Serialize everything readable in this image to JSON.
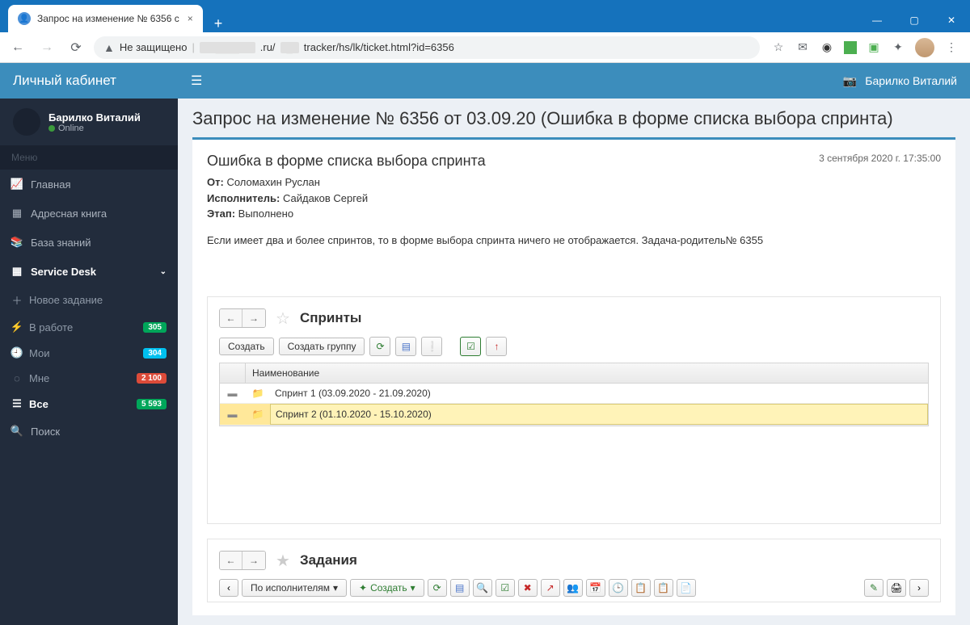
{
  "browser": {
    "tab_title": "Запрос на изменение № 6356 с",
    "url_prefix": "Не защищено",
    "url_path": "tracker/hs/lk/ticket.html?id=6356",
    "url_domain_suffix": ".ru/"
  },
  "app": {
    "logo": "Личный кабинет",
    "user_name": "Барилко Виталий",
    "user_status": "Online",
    "menu_header": "Меню",
    "topbar_user": "Барилко Виталий"
  },
  "nav": {
    "main": "Главная",
    "address": "Адресная книга",
    "kb": "База знаний",
    "sd": "Service Desk",
    "sub": {
      "new": "Новое задание",
      "work": "В работе",
      "mine": "Мои",
      "tome": "Мне",
      "all": "Все"
    },
    "badges": {
      "work": "305",
      "mine": "304",
      "tome": "2 100",
      "all": "5 593"
    },
    "search": "Поиск"
  },
  "page": {
    "title": "Запрос на изменение № 6356 от 03.09.20 (Ошибка в форме списка выбора спринта)",
    "card_title": "Ошибка в форме списка выбора спринта",
    "from_label": "От:",
    "from_value": "Соломахин Руслан",
    "assignee_label": "Исполнитель:",
    "assignee_value": "Сайдаков Сергей",
    "stage_label": "Этап:",
    "stage_value": "Выполнено",
    "date": "3 сентября 2020 г. 17:35:00",
    "body": "Если имеет два и более спринтов, то в форме выбора спринта ничего не отображается. Задача-родитель№ 6355"
  },
  "sprints": {
    "title": "Спринты",
    "create": "Создать",
    "create_group": "Создать группу",
    "col_name": "Наименование",
    "rows": [
      "Спринт 1 (03.09.2020 - 21.09.2020)",
      "Спринт 2 (01.10.2020 - 15.10.2020)"
    ]
  },
  "tasks": {
    "title": "Задания",
    "by_assignee": "По исполнителям",
    "create": "Создать"
  }
}
